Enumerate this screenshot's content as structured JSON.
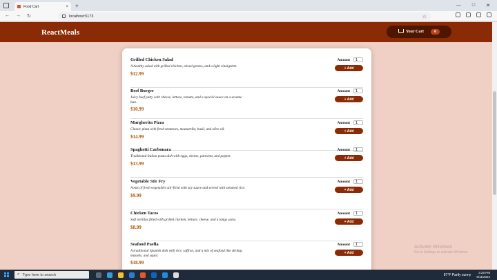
{
  "browser": {
    "tab_title": "Food Cart",
    "tab_close": "×",
    "new_tab": "+",
    "url": "localhost:5173",
    "window_controls": [
      "—",
      "□",
      "✕"
    ],
    "nav": [
      "←",
      "→",
      "↻"
    ]
  },
  "header": {
    "brand": "ReactMeals",
    "cart_label": "Your Cart",
    "cart_count": "0"
  },
  "meals": [
    {
      "name": "Grilled Chicken Salad",
      "description": "A healthy salad with grilled chicken, mixed greens, and a light vinaigrette.",
      "price": "$12.99",
      "amount_label": "Amount",
      "amount": "1",
      "add_label": "+ Add"
    },
    {
      "name": "Beef Burger",
      "description": "Juicy beef patty with cheese, lettuce, tomato, and a special sauce on a sesame bun.",
      "price": "$10.99",
      "amount_label": "Amount",
      "amount": "1",
      "add_label": "+ Add"
    },
    {
      "name": "Margherita Pizza",
      "description": "Classic pizza with fresh tomatoes, mozzarella, basil, and olive oil.",
      "price": "$14.99",
      "amount_label": "Amount",
      "amount": "1",
      "add_label": "+ Add"
    },
    {
      "name": "Spaghetti Carbonara",
      "description": "Traditional Italian pasta dish with eggs, cheese, pancetta, and pepper.",
      "price": "$13.99",
      "amount_label": "Amount",
      "amount": "1",
      "add_label": "+ Add"
    },
    {
      "name": "Vegetable Stir Fry",
      "description": "A mix of fresh vegetables stir-fried with soy sauce and served with steamed rice.",
      "price": "$9.99",
      "amount_label": "Amount",
      "amount": "1",
      "add_label": "+ Add"
    },
    {
      "name": "Chicken Tacos",
      "description": "Soft tortillas filled with grilled chicken, lettuce, cheese, and a tangy salsa.",
      "price": "$8.99",
      "amount_label": "Amount",
      "amount": "1",
      "add_label": "+ Add"
    },
    {
      "name": "Seafood Paella",
      "description": "A traditional Spanish dish with rice, saffron, and a mix of seafood like shrimp, mussels, and squid.",
      "price": "$18.99",
      "amount_label": "Amount",
      "amount": "1",
      "add_label": "+ Add"
    }
  ],
  "watermark": {
    "title": "Activate Windows",
    "subtitle": "Go to Settings to activate Windows."
  },
  "taskbar": {
    "search_placeholder": "Type here to search",
    "weather": "87°F  Partly sunny",
    "time": "3:26 PM",
    "date": "8/11/2024"
  },
  "colors": {
    "header": "#8a2b06",
    "cart_button": "#4d1601",
    "price": "#ad5502",
    "background": "#f0cfc4"
  }
}
